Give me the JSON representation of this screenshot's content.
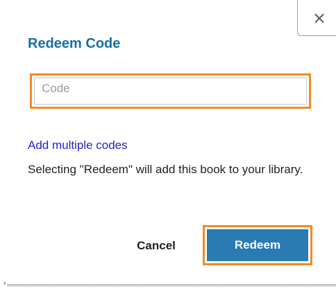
{
  "dialog": {
    "title": "Redeem Code",
    "close_icon": "close-icon",
    "close_glyph": "×",
    "code_input": {
      "value": "",
      "placeholder": "Code"
    },
    "add_multiple_link": "Add multiple codes",
    "info_text": "Selecting \"Redeem\" will add this book to your library.",
    "cancel_label": "Cancel",
    "redeem_label": "Redeem"
  },
  "colors": {
    "title": "#1a6fa0",
    "link": "#2222d6",
    "primary_button": "#2a7bb3",
    "highlight_outline": "#f58a1f"
  }
}
